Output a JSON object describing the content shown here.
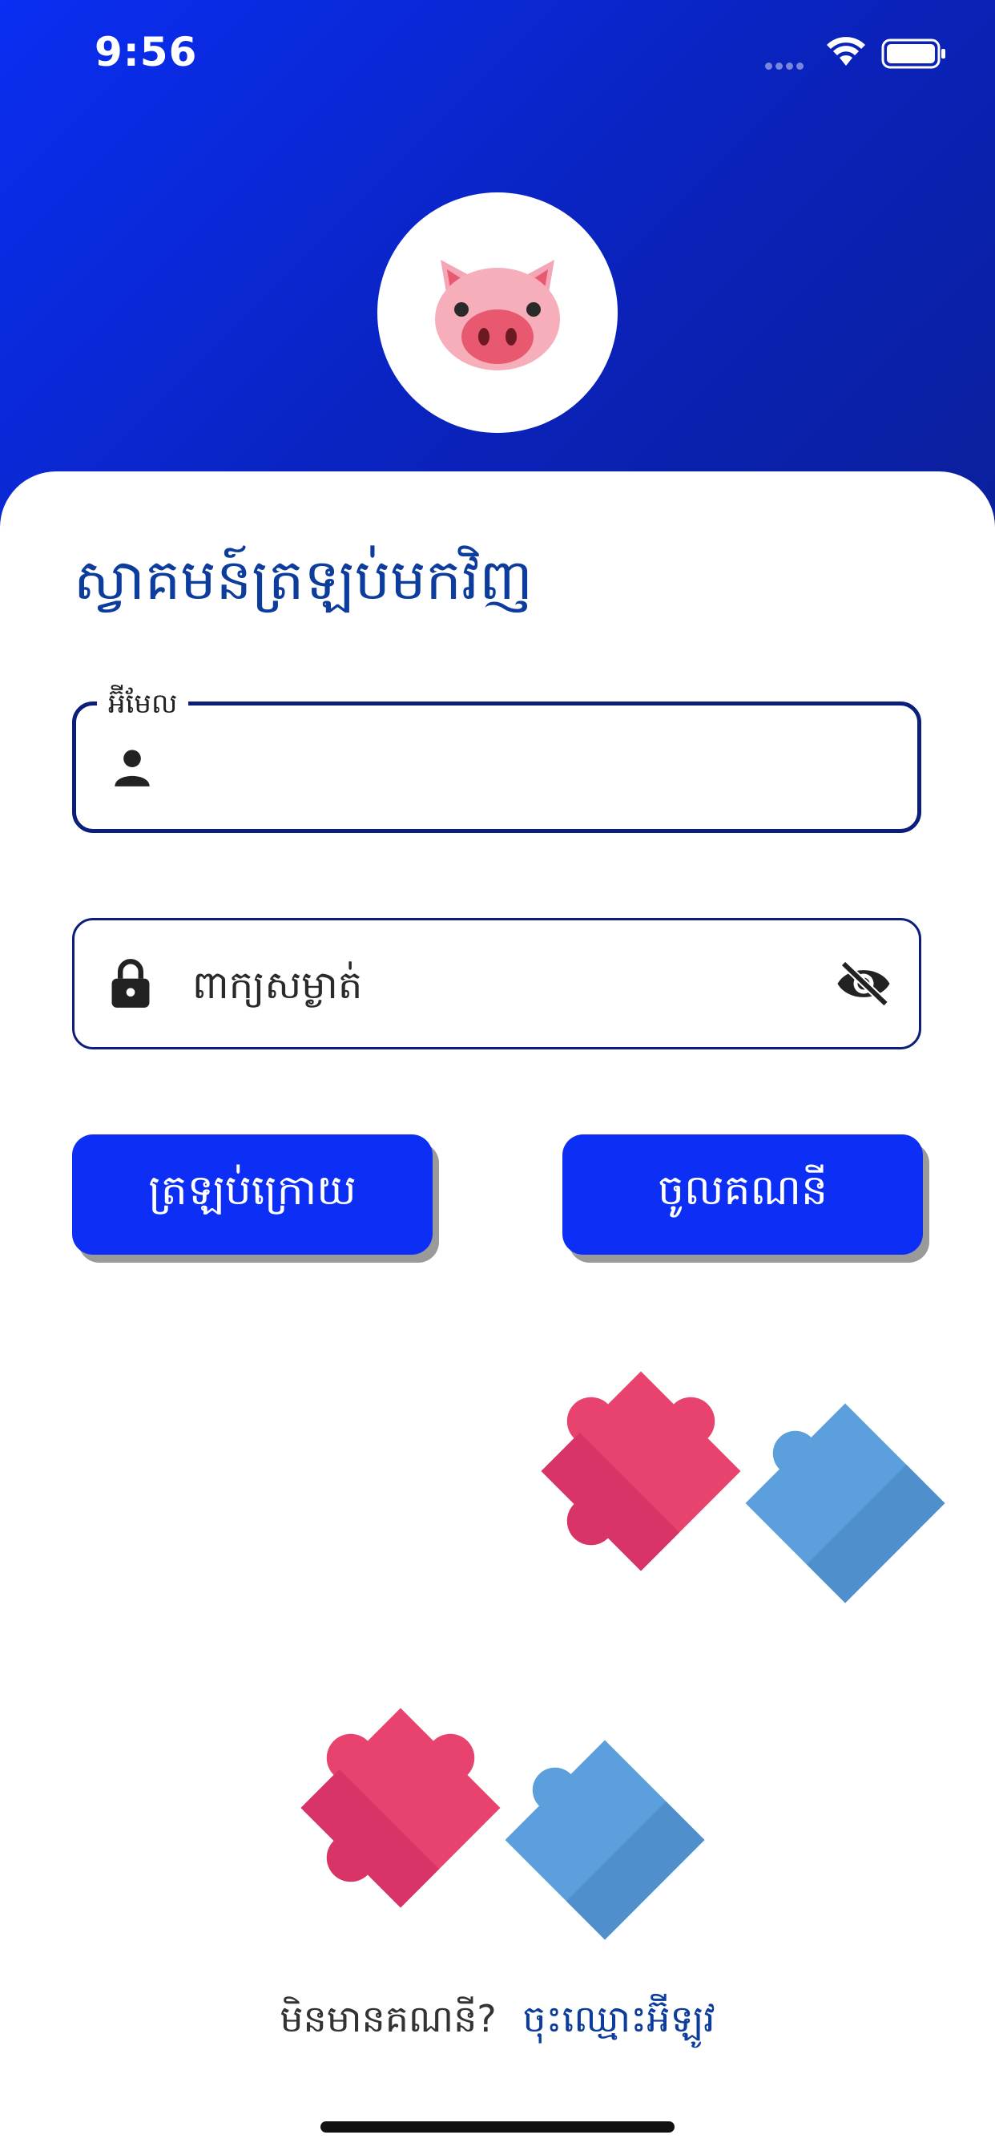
{
  "status_bar": {
    "time": "9:56"
  },
  "login": {
    "title": "ស្វាគមន៍ត្រឡប់មកវិញ",
    "email_label": "អ៊ីមែល",
    "email_value": "",
    "password_placeholder": "ពាក្យសម្ងាត់",
    "back_label": "ត្រឡប់ក្រោយ",
    "login_label": "ចូលគណនី",
    "no_account_text": "មិនមានគណនី?",
    "signup_link": "ចុះឈ្មោះអ៊ីឡូវ"
  },
  "icons": {
    "logo": "pig-face-icon",
    "email": "person-icon",
    "password": "lock-icon",
    "visibility": "eye-off-icon",
    "illustration": "puzzle-pieces-icon"
  },
  "colors": {
    "header_gradient_start": "#0a2ef2",
    "header_gradient_end": "#0b1f99",
    "button": "#0d2ff5",
    "title": "#0d3d9c",
    "field_border": "#0b1f7a",
    "puzzle_pink": "#e8436f",
    "puzzle_blue": "#5b9fdc"
  }
}
